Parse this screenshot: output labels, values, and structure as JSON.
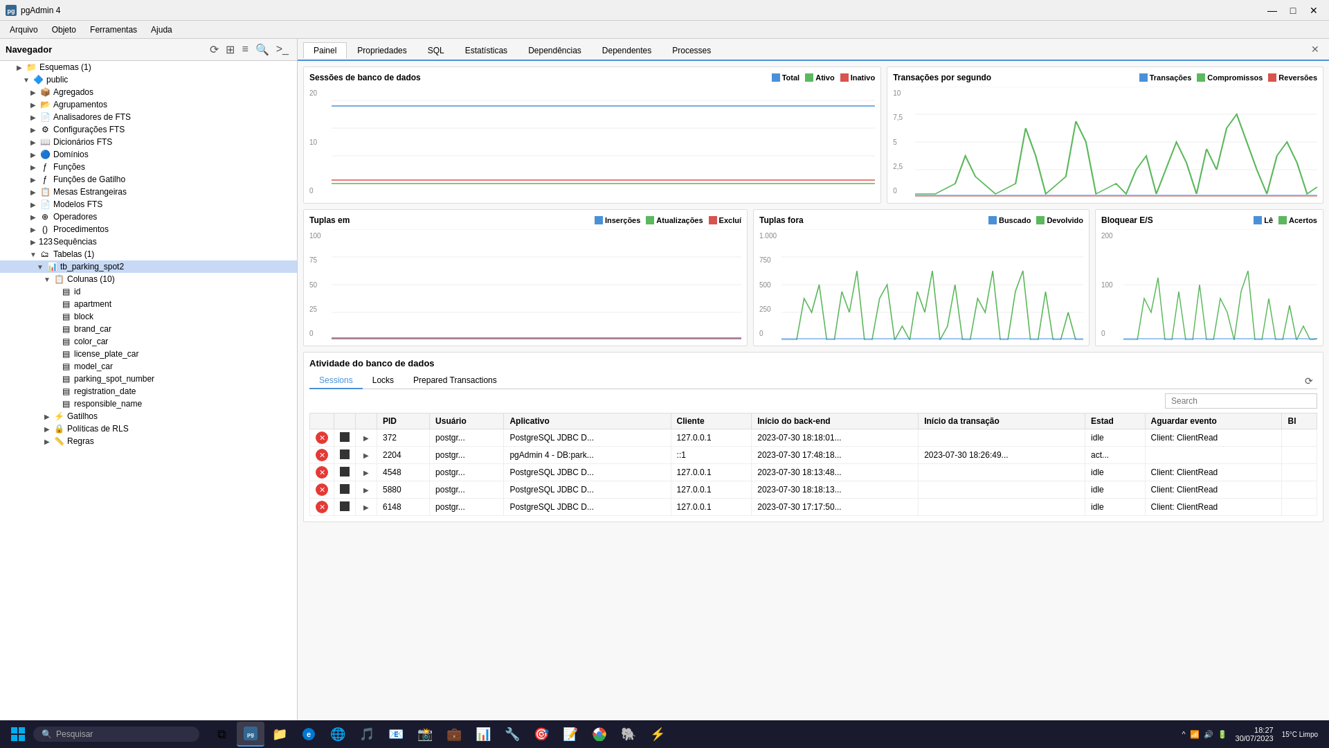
{
  "titlebar": {
    "title": "pgAdmin 4",
    "minimize": "—",
    "maximize": "□",
    "close": "✕"
  },
  "menubar": {
    "items": [
      "Arquivo",
      "Objeto",
      "Ferramentas",
      "Ajuda"
    ]
  },
  "sidebar": {
    "title": "Navegador",
    "tree": [
      {
        "label": "Esquemas (1)",
        "indent": 2,
        "icon": "📁",
        "expander": "▶"
      },
      {
        "label": "public",
        "indent": 3,
        "icon": "🔷",
        "expander": "▼"
      },
      {
        "label": "Agregados",
        "indent": 4,
        "icon": "📦",
        "expander": "▶"
      },
      {
        "label": "Agrupamentos",
        "indent": 4,
        "icon": "📂",
        "expander": "▶"
      },
      {
        "label": "Analisadores de FTS",
        "indent": 4,
        "icon": "📄",
        "expander": "▶"
      },
      {
        "label": "Configurações FTS",
        "indent": 4,
        "icon": "⚙",
        "expander": "▶"
      },
      {
        "label": "Dicionários FTS",
        "indent": 4,
        "icon": "📖",
        "expander": "▶"
      },
      {
        "label": "Domínios",
        "indent": 4,
        "icon": "🔵",
        "expander": "▶"
      },
      {
        "label": "Funções",
        "indent": 4,
        "icon": "ƒ",
        "expander": "▶"
      },
      {
        "label": "Funções de Gatilho",
        "indent": 4,
        "icon": "ƒ",
        "expander": "▶"
      },
      {
        "label": "Mesas Estrangeiras",
        "indent": 4,
        "icon": "📋",
        "expander": "▶"
      },
      {
        "label": "Modelos FTS",
        "indent": 4,
        "icon": "📄",
        "expander": "▶"
      },
      {
        "label": "Operadores",
        "indent": 4,
        "icon": "⊕",
        "expander": "▶"
      },
      {
        "label": "Procedimentos",
        "indent": 4,
        "icon": "()",
        "expander": "▶"
      },
      {
        "label": "Sequências",
        "indent": 4,
        "icon": "123",
        "expander": "▶"
      },
      {
        "label": "Tabelas (1)",
        "indent": 4,
        "icon": "🗂",
        "expander": "▼"
      },
      {
        "label": "tb_parking_spot2",
        "indent": 5,
        "icon": "📊",
        "expander": "▼",
        "selected": true
      },
      {
        "label": "Colunas (10)",
        "indent": 6,
        "icon": "📋",
        "expander": "▼"
      },
      {
        "label": "id",
        "indent": 7,
        "icon": "▤",
        "expander": ""
      },
      {
        "label": "apartment",
        "indent": 7,
        "icon": "▤",
        "expander": ""
      },
      {
        "label": "block",
        "indent": 7,
        "icon": "▤",
        "expander": ""
      },
      {
        "label": "brand_car",
        "indent": 7,
        "icon": "▤",
        "expander": ""
      },
      {
        "label": "color_car",
        "indent": 7,
        "icon": "▤",
        "expander": ""
      },
      {
        "label": "license_plate_car",
        "indent": 7,
        "icon": "▤",
        "expander": ""
      },
      {
        "label": "model_car",
        "indent": 7,
        "icon": "▤",
        "expander": ""
      },
      {
        "label": "parking_spot_number",
        "indent": 7,
        "icon": "▤",
        "expander": ""
      },
      {
        "label": "registration_date",
        "indent": 7,
        "icon": "▤",
        "expander": ""
      },
      {
        "label": "responsible_name",
        "indent": 7,
        "icon": "▤",
        "expander": ""
      },
      {
        "label": "Gatilhos",
        "indent": 6,
        "icon": "⚡",
        "expander": "▶"
      },
      {
        "label": "Políticas de RLS",
        "indent": 6,
        "icon": "🔒",
        "expander": "▶"
      },
      {
        "label": "Regras",
        "indent": 6,
        "icon": "📏",
        "expander": "▶"
      }
    ]
  },
  "tabs": [
    "Painel",
    "Propriedades",
    "SQL",
    "Estatísticas",
    "Dependências",
    "Dependentes",
    "Processes"
  ],
  "active_tab": "Painel",
  "charts": {
    "sessoes": {
      "title": "Sessões de banco de dados",
      "legend": [
        {
          "label": "Total",
          "color": "#4a90d9"
        },
        {
          "label": "Ativo",
          "color": "#5cb85c"
        },
        {
          "label": "Inativo",
          "color": "#d9534f"
        }
      ],
      "y_labels": [
        "20",
        "10",
        "0"
      ]
    },
    "transacoes": {
      "title": "Transações por segundo",
      "legend": [
        {
          "label": "Transações",
          "color": "#4a90d9"
        },
        {
          "label": "Compromissos",
          "color": "#5cb85c"
        },
        {
          "label": "Reversões",
          "color": "#d9534f"
        }
      ],
      "y_labels": [
        "10",
        "7,5",
        "5",
        "2,5",
        "0"
      ]
    },
    "tuplas_em": {
      "title": "Tuplas em",
      "legend": [
        {
          "label": "Inserções",
          "color": "#4a90d9"
        },
        {
          "label": "Atualizações",
          "color": "#5cb85c"
        },
        {
          "label": "Excluí",
          "color": "#d9534f"
        }
      ],
      "y_labels": [
        "100",
        "75",
        "50",
        "25",
        "0"
      ]
    },
    "tuplas_fora": {
      "title": "Tuplas fora",
      "legend": [
        {
          "label": "Buscado",
          "color": "#4a90d9"
        },
        {
          "label": "Devolvido",
          "color": "#5cb85c"
        }
      ],
      "y_labels": [
        "1.000",
        "750",
        "500",
        "250",
        "0"
      ]
    },
    "bloquear": {
      "title": "Bloquear E/S",
      "legend": [
        {
          "label": "Lê",
          "color": "#4a90d9"
        },
        {
          "label": "Acertos",
          "color": "#5cb85c"
        }
      ],
      "y_labels": [
        "200",
        "100",
        "0"
      ]
    }
  },
  "activity": {
    "title": "Atividade do banco de dados",
    "tabs": [
      "Sessions",
      "Locks",
      "Prepared Transactions"
    ],
    "active_tab": "Sessions",
    "search_placeholder": "Search",
    "columns": [
      "",
      "",
      "",
      "PID",
      "Usuário",
      "Aplicativo",
      "Cliente",
      "Início do back-end",
      "Início da transação",
      "Estad",
      "Aguardar evento",
      "Bl"
    ],
    "rows": [
      {
        "pid": "372",
        "usuario": "postgr...",
        "aplicativo": "PostgreSQL JDBC D...",
        "cliente": "127.0.0.1",
        "inicio_backend": "2023-07-30 18:18:01...",
        "inicio_transacao": "",
        "estado": "idle",
        "aguardar": "Client: ClientRead",
        "bl": ""
      },
      {
        "pid": "2204",
        "usuario": "postgr...",
        "aplicativo": "pgAdmin 4 - DB:park...",
        "cliente": "::1",
        "inicio_backend": "2023-07-30 17:48:18...",
        "inicio_transacao": "2023-07-30 18:26:49...",
        "estado": "act...",
        "aguardar": "",
        "bl": ""
      },
      {
        "pid": "4548",
        "usuario": "postgr...",
        "aplicativo": "PostgreSQL JDBC D...",
        "cliente": "127.0.0.1",
        "inicio_backend": "2023-07-30 18:13:48...",
        "inicio_transacao": "",
        "estado": "idle",
        "aguardar": "Client: ClientRead",
        "bl": ""
      },
      {
        "pid": "5880",
        "usuario": "postgr...",
        "aplicativo": "PostgreSQL JDBC D...",
        "cliente": "127.0.0.1",
        "inicio_backend": "2023-07-30 18:18:13...",
        "inicio_transacao": "",
        "estado": "idle",
        "aguardar": "Client: ClientRead",
        "bl": ""
      },
      {
        "pid": "6148",
        "usuario": "postgr...",
        "aplicativo": "PostgreSQL JDBC D...",
        "cliente": "127.0.0.1",
        "inicio_backend": "2023-07-30 17:17:50...",
        "inicio_transacao": "",
        "estado": "idle",
        "aguardar": "Client: ClientRead",
        "bl": ""
      }
    ]
  },
  "taskbar": {
    "search_placeholder": "Pesquisar",
    "time": "18:27",
    "date": "30/07/2023",
    "weather": "15°C Limpo"
  }
}
